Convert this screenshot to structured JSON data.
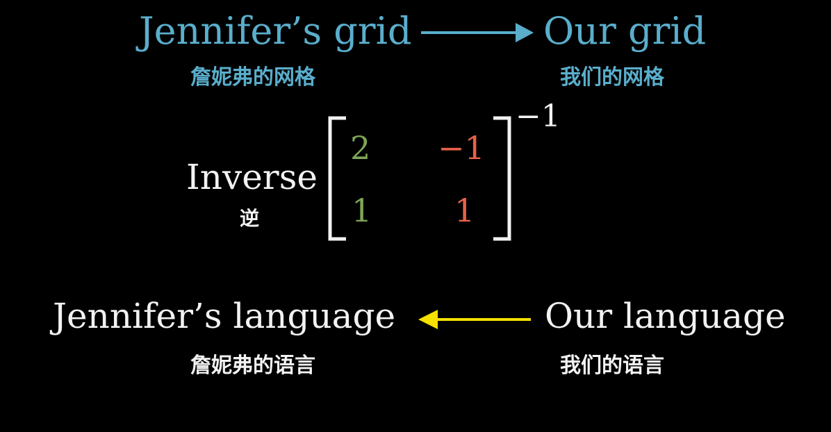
{
  "top": {
    "left_title": "Jennifer’s grid",
    "left_subtitle": "詹妮弗的网格",
    "right_title": "Our grid",
    "right_subtitle": "我们的网格",
    "arrow_color": "#5aaecc"
  },
  "middle": {
    "label": "Inverse",
    "label_sub": "逆",
    "matrix": [
      [
        "2",
        "−1"
      ],
      [
        "1",
        "1"
      ]
    ],
    "exponent": "−1",
    "column_colors": [
      "#7ea556",
      "#e8624a"
    ]
  },
  "bottom": {
    "left_title": "Jennifer’s language",
    "left_subtitle": "詹妮弗的语言",
    "right_title": "Our language",
    "right_subtitle": "我们的语言",
    "arrow_color": "#f5e000"
  }
}
